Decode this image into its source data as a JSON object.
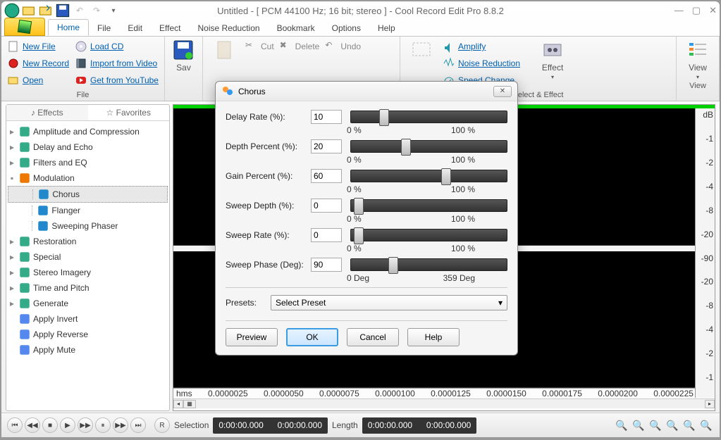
{
  "title": "Untitled - [ PCM 44100 Hz; 16 bit; stereo ] - Cool Record Edit Pro 8.8.2",
  "tabs": [
    "Home",
    "File",
    "Edit",
    "Effect",
    "Noise Reduction",
    "Bookmark",
    "Options",
    "Help"
  ],
  "ribbon": {
    "file": {
      "label": "File",
      "col1": {
        "new_file": "New File",
        "new_record": "New Record",
        "open": "Open"
      },
      "col2": {
        "load_cd": "Load CD",
        "import_video": "Import from Video",
        "youtube": "Get from YouTube"
      }
    },
    "save_label": "Sav",
    "clipboard": {
      "cut": "Cut",
      "delete": "Delete",
      "undo": "Undo"
    },
    "sel_effect": {
      "label": "Select & Effect",
      "amplify": "Amplify",
      "noise": "Noise Reduction",
      "speed": "Speed Change",
      "effect": "Effect"
    },
    "view": {
      "label": "View",
      "view": "View"
    }
  },
  "sidebar": {
    "tabs": {
      "effects": "Effects",
      "favorites": "Favorites"
    },
    "items": [
      {
        "t": "Amplitude and Compression",
        "k": "n"
      },
      {
        "t": "Delay and Echo",
        "k": "n"
      },
      {
        "t": "Filters and EQ",
        "k": "n"
      },
      {
        "t": "Modulation",
        "k": "o"
      },
      {
        "t": "Chorus",
        "k": "l",
        "sel": true
      },
      {
        "t": "Flanger",
        "k": "l"
      },
      {
        "t": "Sweeping Phaser",
        "k": "l"
      },
      {
        "t": "Restoration",
        "k": "n"
      },
      {
        "t": "Special",
        "k": "n"
      },
      {
        "t": "Stereo Imagery",
        "k": "n"
      },
      {
        "t": "Time and Pitch",
        "k": "n"
      },
      {
        "t": "Generate",
        "k": "n"
      },
      {
        "t": "Apply Invert",
        "k": "a"
      },
      {
        "t": "Apply Reverse",
        "k": "a"
      },
      {
        "t": "Apply Mute",
        "k": "a"
      }
    ]
  },
  "timeline": {
    "unit": "hms",
    "ticks": [
      "0.0000025",
      "0.0000050",
      "0.0000075",
      "0.0000100",
      "0.0000125",
      "0.0000150",
      "0.0000175",
      "0.0000200",
      "0.0000225"
    ]
  },
  "meter_db": [
    "dB",
    "-1",
    "-2",
    "-4",
    "-8",
    "-20",
    "-90",
    "-20",
    "-8",
    "-4",
    "-2",
    "-1"
  ],
  "bottom": {
    "selection_label": "Selection",
    "length_label": "Length",
    "sel_start": "0:00:00.000",
    "sel_end": "0:00:00.000",
    "len_start": "0:00:00.000",
    "len_end": "0:00:00.000"
  },
  "dialog": {
    "title": "Chorus",
    "params": [
      {
        "label": "Delay Rate (%):",
        "value": "10",
        "min": "0 %",
        "max": "100 %",
        "pos": 18
      },
      {
        "label": "Depth Percent (%):",
        "value": "20",
        "min": "0 %",
        "max": "100 %",
        "pos": 32
      },
      {
        "label": "Gain Percent (%):",
        "value": "60",
        "min": "0 %",
        "max": "100 %",
        "pos": 58
      },
      {
        "label": "Sweep Depth (%):",
        "value": "0",
        "min": "0 %",
        "max": "100 %",
        "pos": 2
      },
      {
        "label": "Sweep Rate (%):",
        "value": "0",
        "min": "0 %",
        "max": "100 %",
        "pos": 2
      },
      {
        "label": "Sweep Phase (Deg):",
        "value": "90",
        "min": "0 Deg",
        "max": "359 Deg",
        "pos": 24
      }
    ],
    "presets_label": "Presets:",
    "preset_selected": "Select Preset",
    "buttons": {
      "preview": "Preview",
      "ok": "OK",
      "cancel": "Cancel",
      "help": "Help"
    }
  }
}
